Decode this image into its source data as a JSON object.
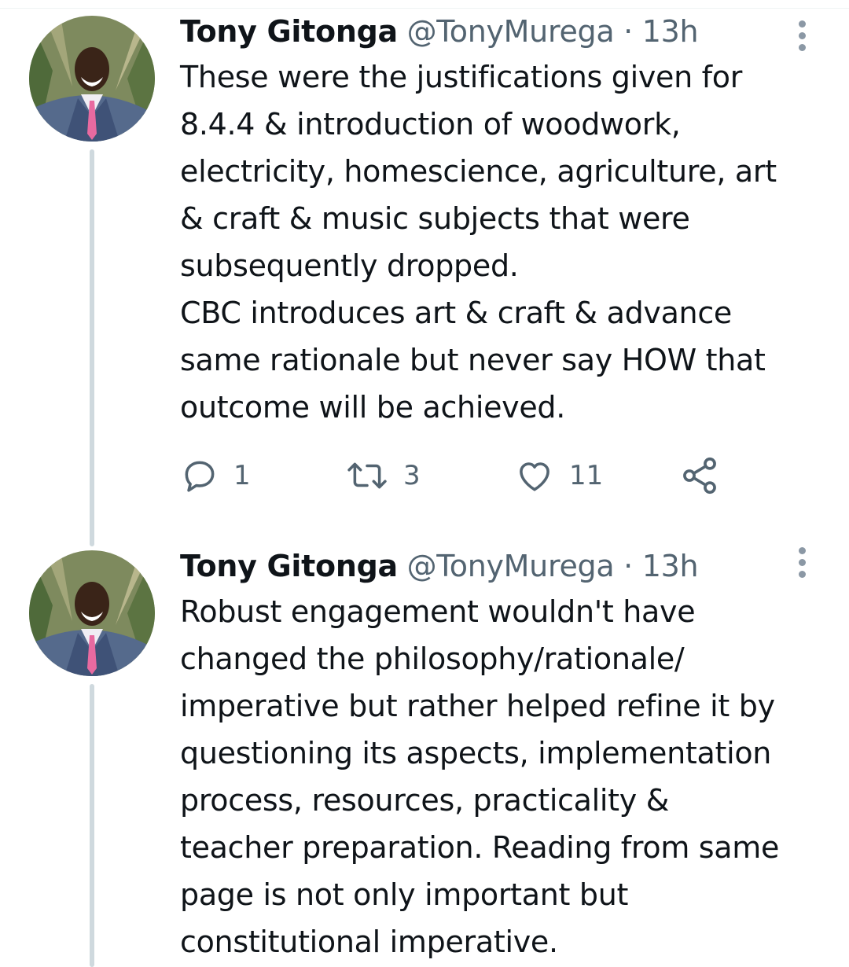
{
  "tweets": [
    {
      "author_name": "Tony Gitonga",
      "handle": "@TonyMurega",
      "separator": "·",
      "time": "13h",
      "lines": [
        "These were the justifications given for",
        "8.4.4 & introduction of woodwork,",
        "electricity, homescience, agriculture, art",
        "& craft & music subjects that were",
        "subsequently dropped.",
        "CBC introduces art & craft & advance",
        "same rationale but never say HOW that",
        "outcome will be achieved."
      ],
      "actions": {
        "reply_count": "1",
        "retweet_count": "3",
        "like_count": "11"
      }
    },
    {
      "author_name": "Tony Gitonga",
      "handle": "@TonyMurega",
      "separator": "·",
      "time": "13h",
      "lines": [
        "Robust engagement wouldn't have",
        "changed the philosophy/rationale/",
        "imperative but rather helped refine it by",
        "questioning its aspects, implementation",
        "process, resources, practicality &",
        "teacher preparation. Reading from same",
        "page is not only important but",
        "constitutional imperative."
      ]
    }
  ],
  "icons": {
    "reply": "speech-bubble-icon",
    "retweet": "retweet-arrows-icon",
    "like": "heart-icon",
    "share": "share-icon",
    "more": "vertical-dots-icon"
  },
  "colors": {
    "text": "#0f1419",
    "secondary": "#536471",
    "thread_line": "#cfd9de"
  }
}
